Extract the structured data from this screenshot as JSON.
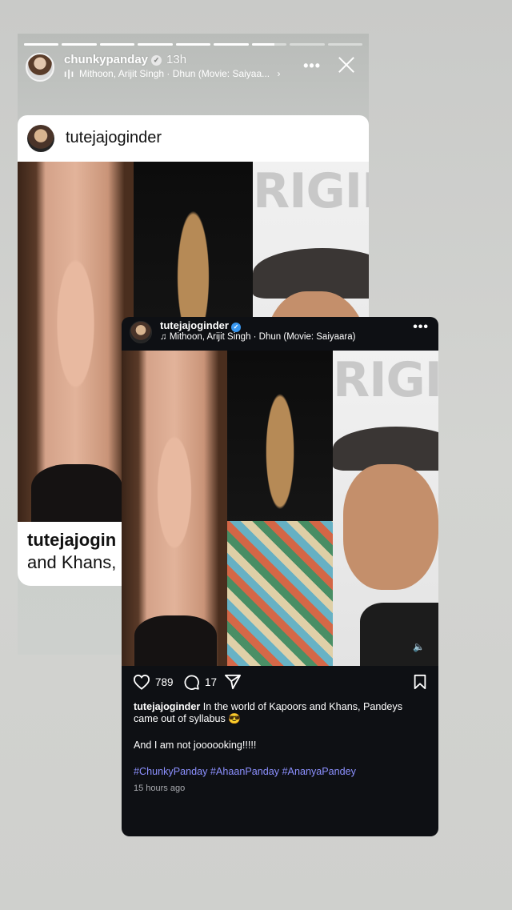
{
  "story": {
    "progress_fraction": 0.74,
    "segments": 9,
    "user": "chunkypanday",
    "time": "13h",
    "music": "Mithoon, Arijit Singh · Dhun (Movie: Saiyaa...",
    "more_label": "•••"
  },
  "background_post": {
    "user": "tutejajoginder",
    "caption_user": "tutejajogin",
    "caption_text": "and Khans,",
    "image_text": "RIGIN"
  },
  "post": {
    "user": "tutejajoginder",
    "music": "Mithoon, Arijit Singh · Dhun (Movie: Saiyaara)",
    "more_label": "•••",
    "image_text": "RIGIN",
    "likes": "789",
    "comments": "17",
    "caption_user": "tutejajoginder",
    "caption_text": "In the world of Kapoors and Khans, Pandeys came out of syllabus 😎",
    "caption_line2": "And I am not joooooking!!!!!",
    "hashtags": "#ChunkyPanday #AhaanPanday #AnanyaPandey",
    "time": "15 hours ago"
  },
  "colors": {
    "post_background": "#0e1014",
    "hashtag": "#8c90ff",
    "verified": "#3897f0"
  }
}
